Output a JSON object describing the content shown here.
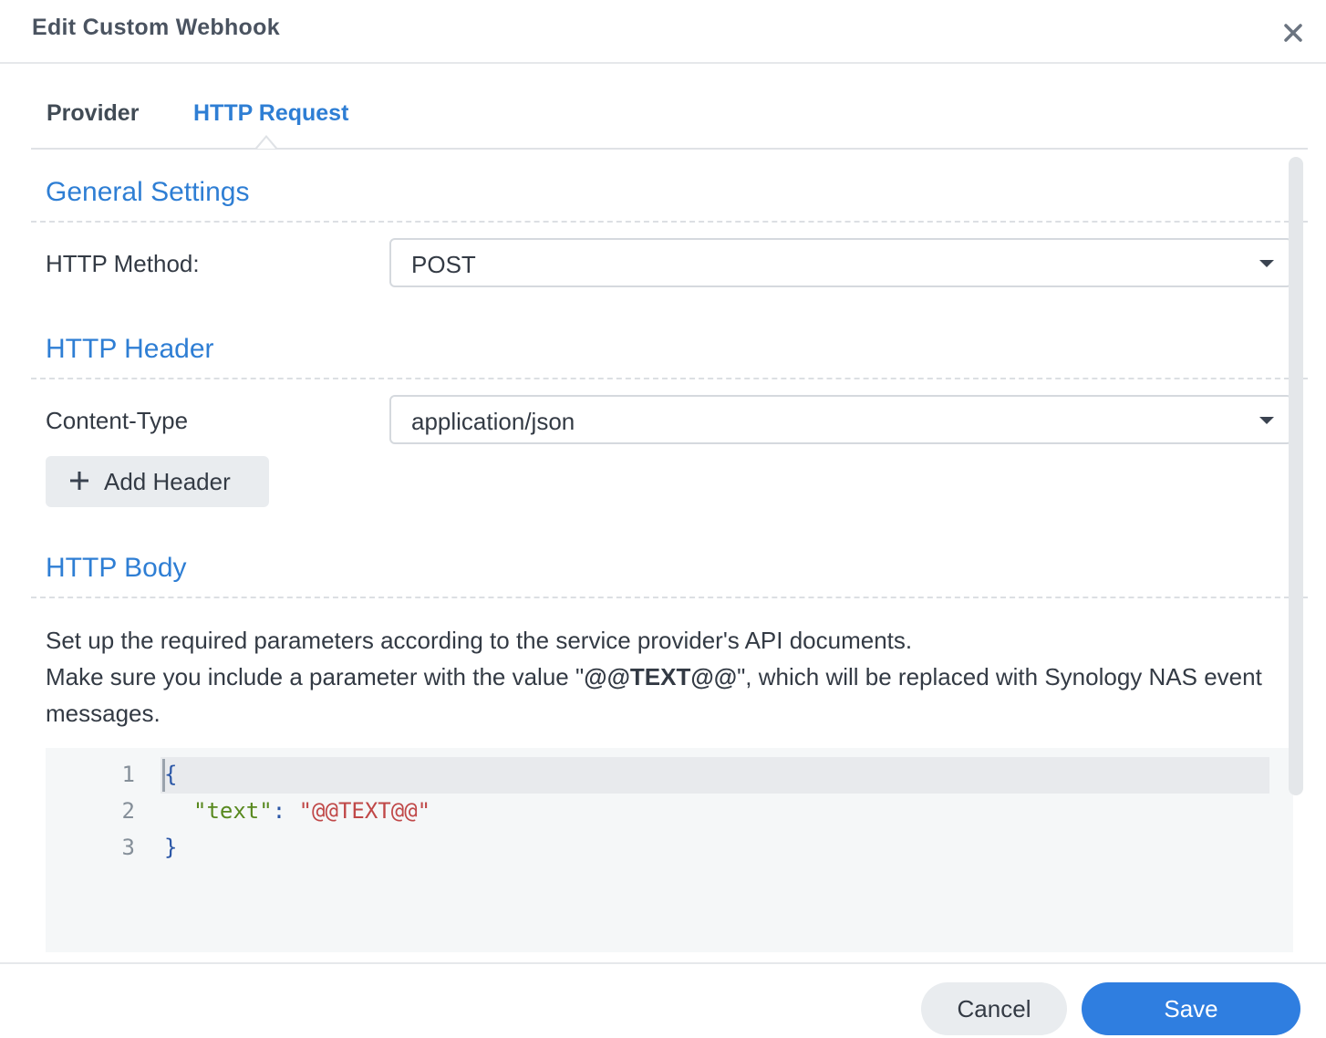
{
  "dialog": {
    "title": "Edit Custom Webhook",
    "close_icon": "close-icon"
  },
  "tabs": [
    {
      "label": "Provider",
      "active": false
    },
    {
      "label": "HTTP Request",
      "active": true
    }
  ],
  "general_settings": {
    "title": "General Settings",
    "http_method_label": "HTTP Method:",
    "http_method_value": "POST"
  },
  "http_header": {
    "title": "HTTP Header",
    "content_type_label": "Content-Type",
    "content_type_value": "application/json",
    "add_header_label": "Add Header"
  },
  "http_body": {
    "title": "HTTP Body",
    "desc_line1": "Set up the required parameters according to the service provider's API documents.",
    "desc_line2_before": "Make sure you include a parameter with the value \"",
    "desc_bold": "@@TEXT@@",
    "desc_line2_after": "\", which will be replaced with Synology NAS event messages.",
    "code": {
      "line_numbers": [
        "1",
        "2",
        "3"
      ],
      "open_brace": "{",
      "key": "\"text\"",
      "colon": ": ",
      "value": "\"@@TEXT@@\"",
      "close_brace": "}"
    }
  },
  "footer": {
    "cancel_label": "Cancel",
    "save_label": "Save"
  },
  "colors": {
    "accent": "#2e7ed4",
    "save_button": "#2f7ee0",
    "code_key": "#58891f",
    "code_string": "#c04848"
  }
}
